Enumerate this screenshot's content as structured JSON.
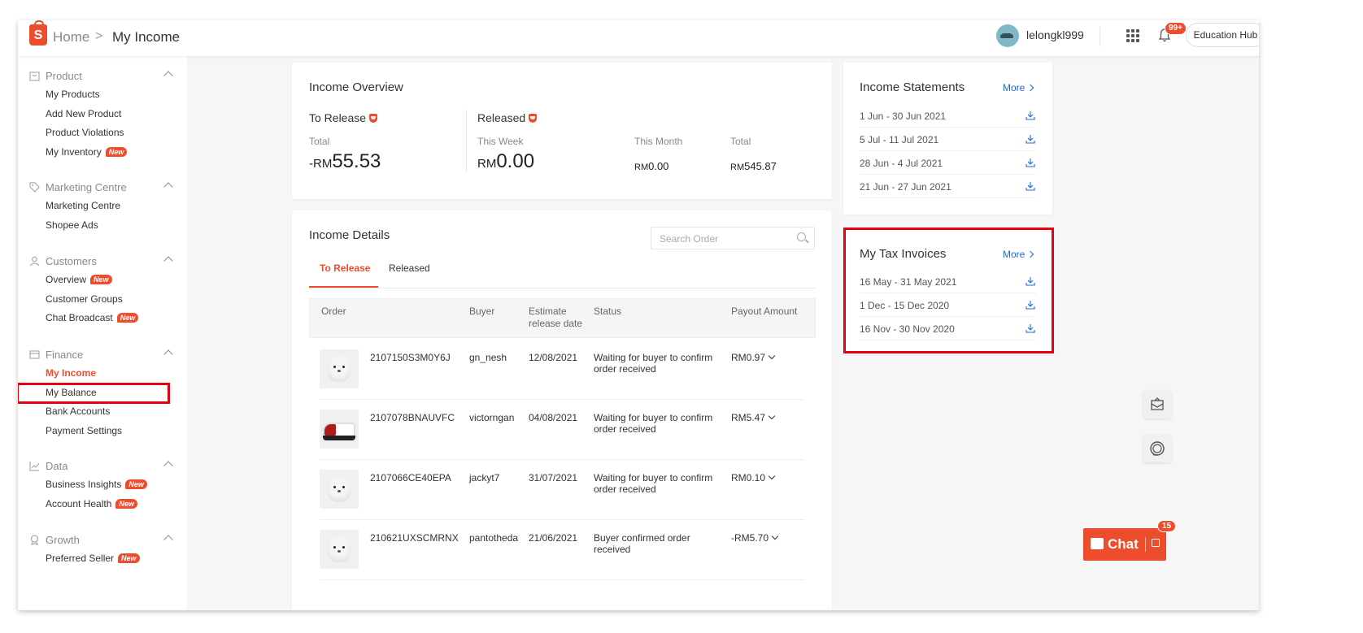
{
  "header": {
    "home": "Home",
    "separator": ">",
    "current": "My Income",
    "username": "lelongkl999",
    "notif_count": "99+",
    "edu_hub": "Education Hub"
  },
  "sidebar": {
    "sections": [
      {
        "title": "Product",
        "items": [
          {
            "label": "My Products"
          },
          {
            "label": "Add New Product"
          },
          {
            "label": "Product Violations"
          },
          {
            "label": "My Inventory",
            "badge": "New"
          }
        ]
      },
      {
        "title": "Marketing Centre",
        "items": [
          {
            "label": "Marketing Centre"
          },
          {
            "label": "Shopee Ads"
          }
        ]
      },
      {
        "title": "Customers",
        "items": [
          {
            "label": "Overview",
            "badge": "New"
          },
          {
            "label": "Customer Groups"
          },
          {
            "label": "Chat Broadcast",
            "badge": "New"
          }
        ]
      },
      {
        "title": "Finance",
        "items": [
          {
            "label": "My Income"
          },
          {
            "label": "My Balance"
          },
          {
            "label": "Bank Accounts"
          },
          {
            "label": "Payment Settings"
          }
        ]
      },
      {
        "title": "Data",
        "items": [
          {
            "label": "Business Insights",
            "badge": "New"
          },
          {
            "label": "Account Health",
            "badge": "New"
          }
        ]
      },
      {
        "title": "Growth",
        "items": [
          {
            "label": "Preferred Seller",
            "badge": "New"
          }
        ]
      }
    ]
  },
  "overview": {
    "title": "Income Overview",
    "to_release": {
      "label": "To Release",
      "total_label": "Total",
      "currency": "-RM",
      "amount": "55.53"
    },
    "released": {
      "label": "Released",
      "week_label": "This Week",
      "week_currency": "RM",
      "week_amount": "0.00",
      "month_label": "This Month",
      "month_currency": "RM",
      "month_amount": "0.00",
      "total_label": "Total",
      "total_currency": "RM",
      "total_amount": "545.87"
    }
  },
  "details": {
    "title": "Income Details",
    "search_placeholder": "Search Order",
    "tabs": [
      "To Release",
      "Released"
    ],
    "columns": {
      "order": "Order",
      "buyer": "Buyer",
      "estimate_line1": "Estimate",
      "estimate_line2": "release date",
      "status": "Status",
      "payout": "Payout Amount"
    },
    "rows": [
      {
        "order": "2107150S3M0Y6J",
        "buyer": "gn_nesh",
        "date": "12/08/2021",
        "status_l1": "Waiting for buyer to confirm",
        "status_l2": "order received",
        "payout": "RM0.97",
        "thumb": "seal"
      },
      {
        "order": "2107078BNAUVFC",
        "buyer": "victorngan",
        "date": "04/08/2021",
        "status_l1": "Waiting for buyer to confirm",
        "status_l2": "order received",
        "payout": "RM5.47",
        "thumb": "shoe"
      },
      {
        "order": "2107066CE40EPA",
        "buyer": "jackyt7",
        "date": "31/07/2021",
        "status_l1": "Waiting for buyer to confirm",
        "status_l2": "order received",
        "payout": "RM0.10",
        "thumb": "seal"
      },
      {
        "order": "210621UXSCMRNX",
        "buyer": "pantotheda",
        "date": "21/06/2021",
        "status_l1": "Buyer confirmed order",
        "status_l2": "received",
        "payout": "-RM5.70",
        "thumb": "seal"
      }
    ]
  },
  "statements": {
    "title": "Income Statements",
    "more": "More",
    "items": [
      "1 Jun - 30 Jun 2021",
      "5 Jul - 11 Jul 2021",
      "28 Jun - 4 Jul 2021",
      "21 Jun - 27 Jun 2021"
    ]
  },
  "tax": {
    "title": "My Tax Invoices",
    "more": "More",
    "items": [
      "16 May - 31 May 2021",
      "1 Dec - 15 Dec 2020",
      "16 Nov - 30 Nov 2020"
    ]
  },
  "chat": {
    "label": "Chat",
    "badge": "15"
  },
  "colors": {
    "accent": "#ee4d2d",
    "link": "#1e6ad6",
    "highlight": "#e60012"
  }
}
